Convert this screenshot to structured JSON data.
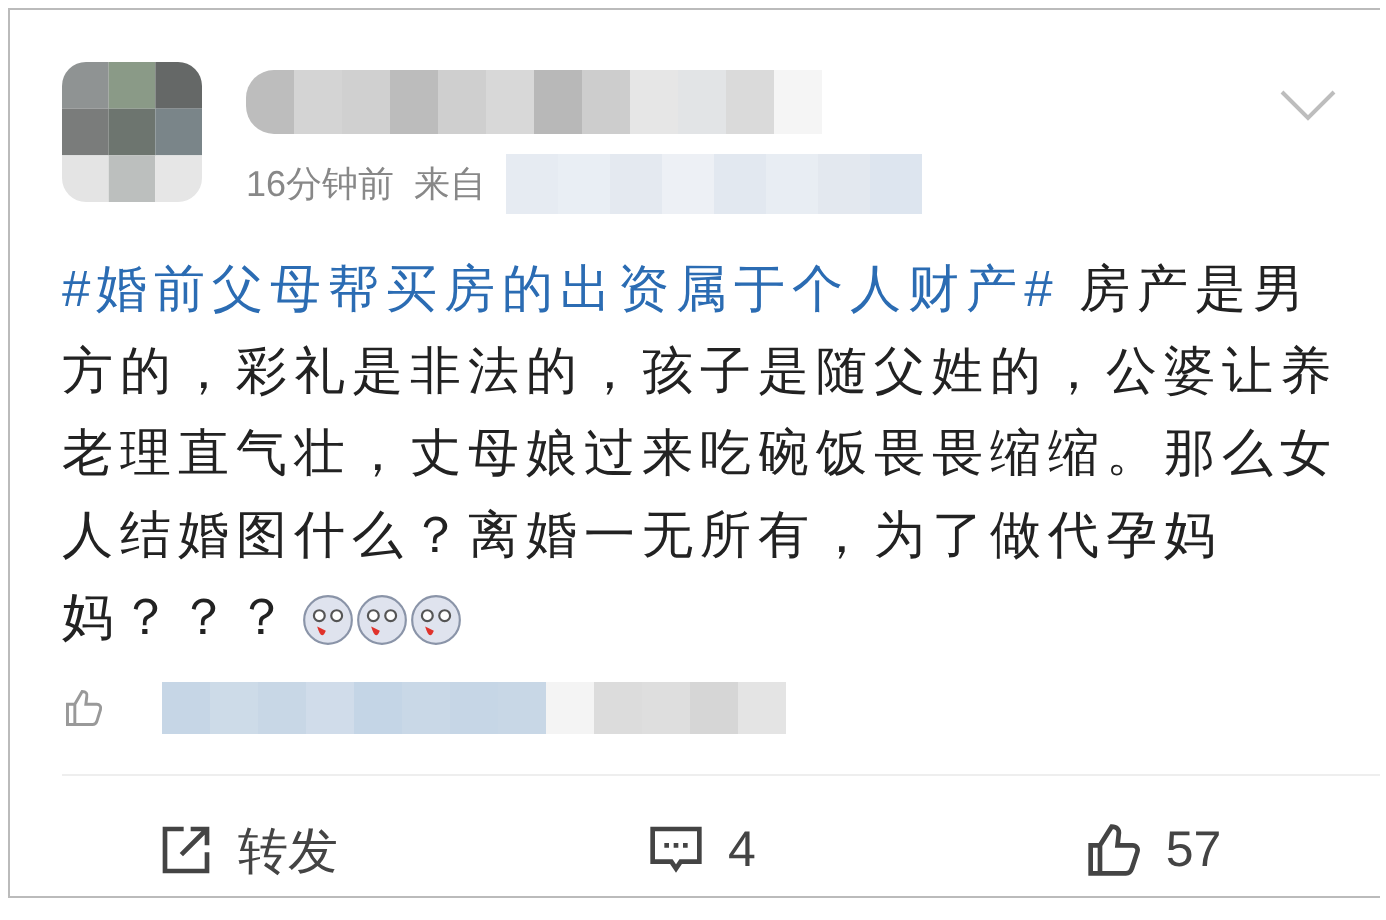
{
  "post": {
    "time": "16分钟前",
    "source_label": "来自",
    "topic": "#婚前父母帮买房的出资属于个人财产#",
    "text": " 房产是男方的，彩礼是非法的，孩子是随父姓的，公婆让养老理直气壮，丈母娘过来吃碗饭畏畏缩缩。那么女人结婚图什么？离婚一无所有，为了做代孕妈妈？？？",
    "emojis": [
      {
        "kind": "face"
      },
      {
        "kind": "face"
      },
      {
        "kind": "face"
      }
    ]
  },
  "actions": [
    {
      "kind": "repost",
      "label": "转发"
    },
    {
      "kind": "comment",
      "label": "4"
    },
    {
      "kind": "like",
      "label": "57"
    }
  ]
}
